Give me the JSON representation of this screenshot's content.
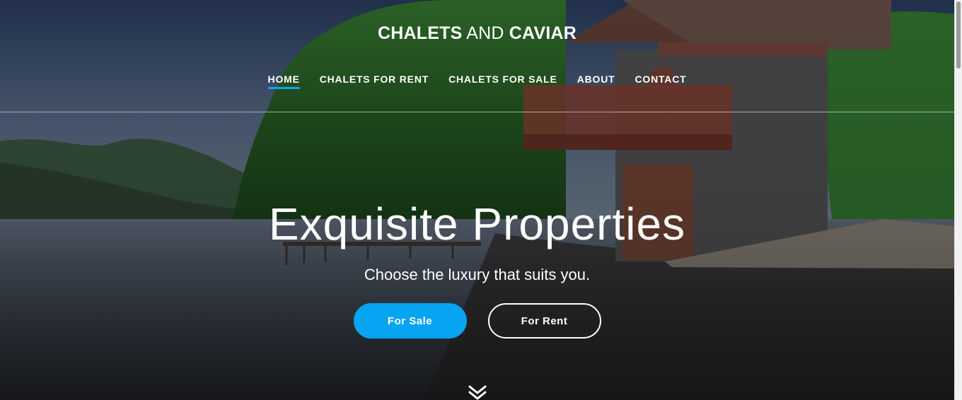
{
  "brand": {
    "part1": "CHALETS",
    "part2": "AND",
    "part3": "CAVIAR"
  },
  "nav": {
    "items": [
      {
        "label": "HOME",
        "active": true
      },
      {
        "label": "CHALETS FOR RENT",
        "active": false
      },
      {
        "label": "CHALETS FOR SALE",
        "active": false
      },
      {
        "label": "ABOUT",
        "active": false
      },
      {
        "label": "CONTACT",
        "active": false
      }
    ]
  },
  "hero": {
    "headline": "Exquisite Properties",
    "subheadline": "Choose the luxury that suits you.",
    "buttons": {
      "sale": "For Sale",
      "rent": "For Rent"
    },
    "scroll_icon": "double-chevron-down-icon"
  },
  "colors": {
    "accent": "#07a4f2",
    "text": "#ffffff"
  }
}
